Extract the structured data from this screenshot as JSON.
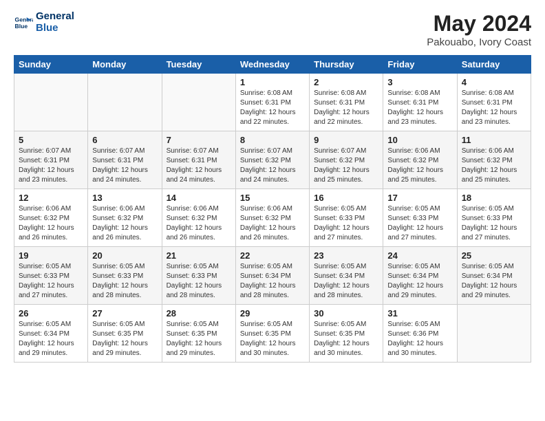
{
  "header": {
    "logo_line1": "General",
    "logo_line2": "Blue",
    "month": "May 2024",
    "location": "Pakouabo, Ivory Coast"
  },
  "days_of_week": [
    "Sunday",
    "Monday",
    "Tuesday",
    "Wednesday",
    "Thursday",
    "Friday",
    "Saturday"
  ],
  "weeks": [
    [
      {
        "day": "",
        "info": ""
      },
      {
        "day": "",
        "info": ""
      },
      {
        "day": "",
        "info": ""
      },
      {
        "day": "1",
        "info": "Sunrise: 6:08 AM\nSunset: 6:31 PM\nDaylight: 12 hours\nand 22 minutes."
      },
      {
        "day": "2",
        "info": "Sunrise: 6:08 AM\nSunset: 6:31 PM\nDaylight: 12 hours\nand 22 minutes."
      },
      {
        "day": "3",
        "info": "Sunrise: 6:08 AM\nSunset: 6:31 PM\nDaylight: 12 hours\nand 23 minutes."
      },
      {
        "day": "4",
        "info": "Sunrise: 6:08 AM\nSunset: 6:31 PM\nDaylight: 12 hours\nand 23 minutes."
      }
    ],
    [
      {
        "day": "5",
        "info": "Sunrise: 6:07 AM\nSunset: 6:31 PM\nDaylight: 12 hours\nand 23 minutes."
      },
      {
        "day": "6",
        "info": "Sunrise: 6:07 AM\nSunset: 6:31 PM\nDaylight: 12 hours\nand 24 minutes."
      },
      {
        "day": "7",
        "info": "Sunrise: 6:07 AM\nSunset: 6:31 PM\nDaylight: 12 hours\nand 24 minutes."
      },
      {
        "day": "8",
        "info": "Sunrise: 6:07 AM\nSunset: 6:32 PM\nDaylight: 12 hours\nand 24 minutes."
      },
      {
        "day": "9",
        "info": "Sunrise: 6:07 AM\nSunset: 6:32 PM\nDaylight: 12 hours\nand 25 minutes."
      },
      {
        "day": "10",
        "info": "Sunrise: 6:06 AM\nSunset: 6:32 PM\nDaylight: 12 hours\nand 25 minutes."
      },
      {
        "day": "11",
        "info": "Sunrise: 6:06 AM\nSunset: 6:32 PM\nDaylight: 12 hours\nand 25 minutes."
      }
    ],
    [
      {
        "day": "12",
        "info": "Sunrise: 6:06 AM\nSunset: 6:32 PM\nDaylight: 12 hours\nand 26 minutes."
      },
      {
        "day": "13",
        "info": "Sunrise: 6:06 AM\nSunset: 6:32 PM\nDaylight: 12 hours\nand 26 minutes."
      },
      {
        "day": "14",
        "info": "Sunrise: 6:06 AM\nSunset: 6:32 PM\nDaylight: 12 hours\nand 26 minutes."
      },
      {
        "day": "15",
        "info": "Sunrise: 6:06 AM\nSunset: 6:32 PM\nDaylight: 12 hours\nand 26 minutes."
      },
      {
        "day": "16",
        "info": "Sunrise: 6:05 AM\nSunset: 6:33 PM\nDaylight: 12 hours\nand 27 minutes."
      },
      {
        "day": "17",
        "info": "Sunrise: 6:05 AM\nSunset: 6:33 PM\nDaylight: 12 hours\nand 27 minutes."
      },
      {
        "day": "18",
        "info": "Sunrise: 6:05 AM\nSunset: 6:33 PM\nDaylight: 12 hours\nand 27 minutes."
      }
    ],
    [
      {
        "day": "19",
        "info": "Sunrise: 6:05 AM\nSunset: 6:33 PM\nDaylight: 12 hours\nand 27 minutes."
      },
      {
        "day": "20",
        "info": "Sunrise: 6:05 AM\nSunset: 6:33 PM\nDaylight: 12 hours\nand 28 minutes."
      },
      {
        "day": "21",
        "info": "Sunrise: 6:05 AM\nSunset: 6:33 PM\nDaylight: 12 hours\nand 28 minutes."
      },
      {
        "day": "22",
        "info": "Sunrise: 6:05 AM\nSunset: 6:34 PM\nDaylight: 12 hours\nand 28 minutes."
      },
      {
        "day": "23",
        "info": "Sunrise: 6:05 AM\nSunset: 6:34 PM\nDaylight: 12 hours\nand 28 minutes."
      },
      {
        "day": "24",
        "info": "Sunrise: 6:05 AM\nSunset: 6:34 PM\nDaylight: 12 hours\nand 29 minutes."
      },
      {
        "day": "25",
        "info": "Sunrise: 6:05 AM\nSunset: 6:34 PM\nDaylight: 12 hours\nand 29 minutes."
      }
    ],
    [
      {
        "day": "26",
        "info": "Sunrise: 6:05 AM\nSunset: 6:34 PM\nDaylight: 12 hours\nand 29 minutes."
      },
      {
        "day": "27",
        "info": "Sunrise: 6:05 AM\nSunset: 6:35 PM\nDaylight: 12 hours\nand 29 minutes."
      },
      {
        "day": "28",
        "info": "Sunrise: 6:05 AM\nSunset: 6:35 PM\nDaylight: 12 hours\nand 29 minutes."
      },
      {
        "day": "29",
        "info": "Sunrise: 6:05 AM\nSunset: 6:35 PM\nDaylight: 12 hours\nand 30 minutes."
      },
      {
        "day": "30",
        "info": "Sunrise: 6:05 AM\nSunset: 6:35 PM\nDaylight: 12 hours\nand 30 minutes."
      },
      {
        "day": "31",
        "info": "Sunrise: 6:05 AM\nSunset: 6:36 PM\nDaylight: 12 hours\nand 30 minutes."
      },
      {
        "day": "",
        "info": ""
      }
    ]
  ]
}
